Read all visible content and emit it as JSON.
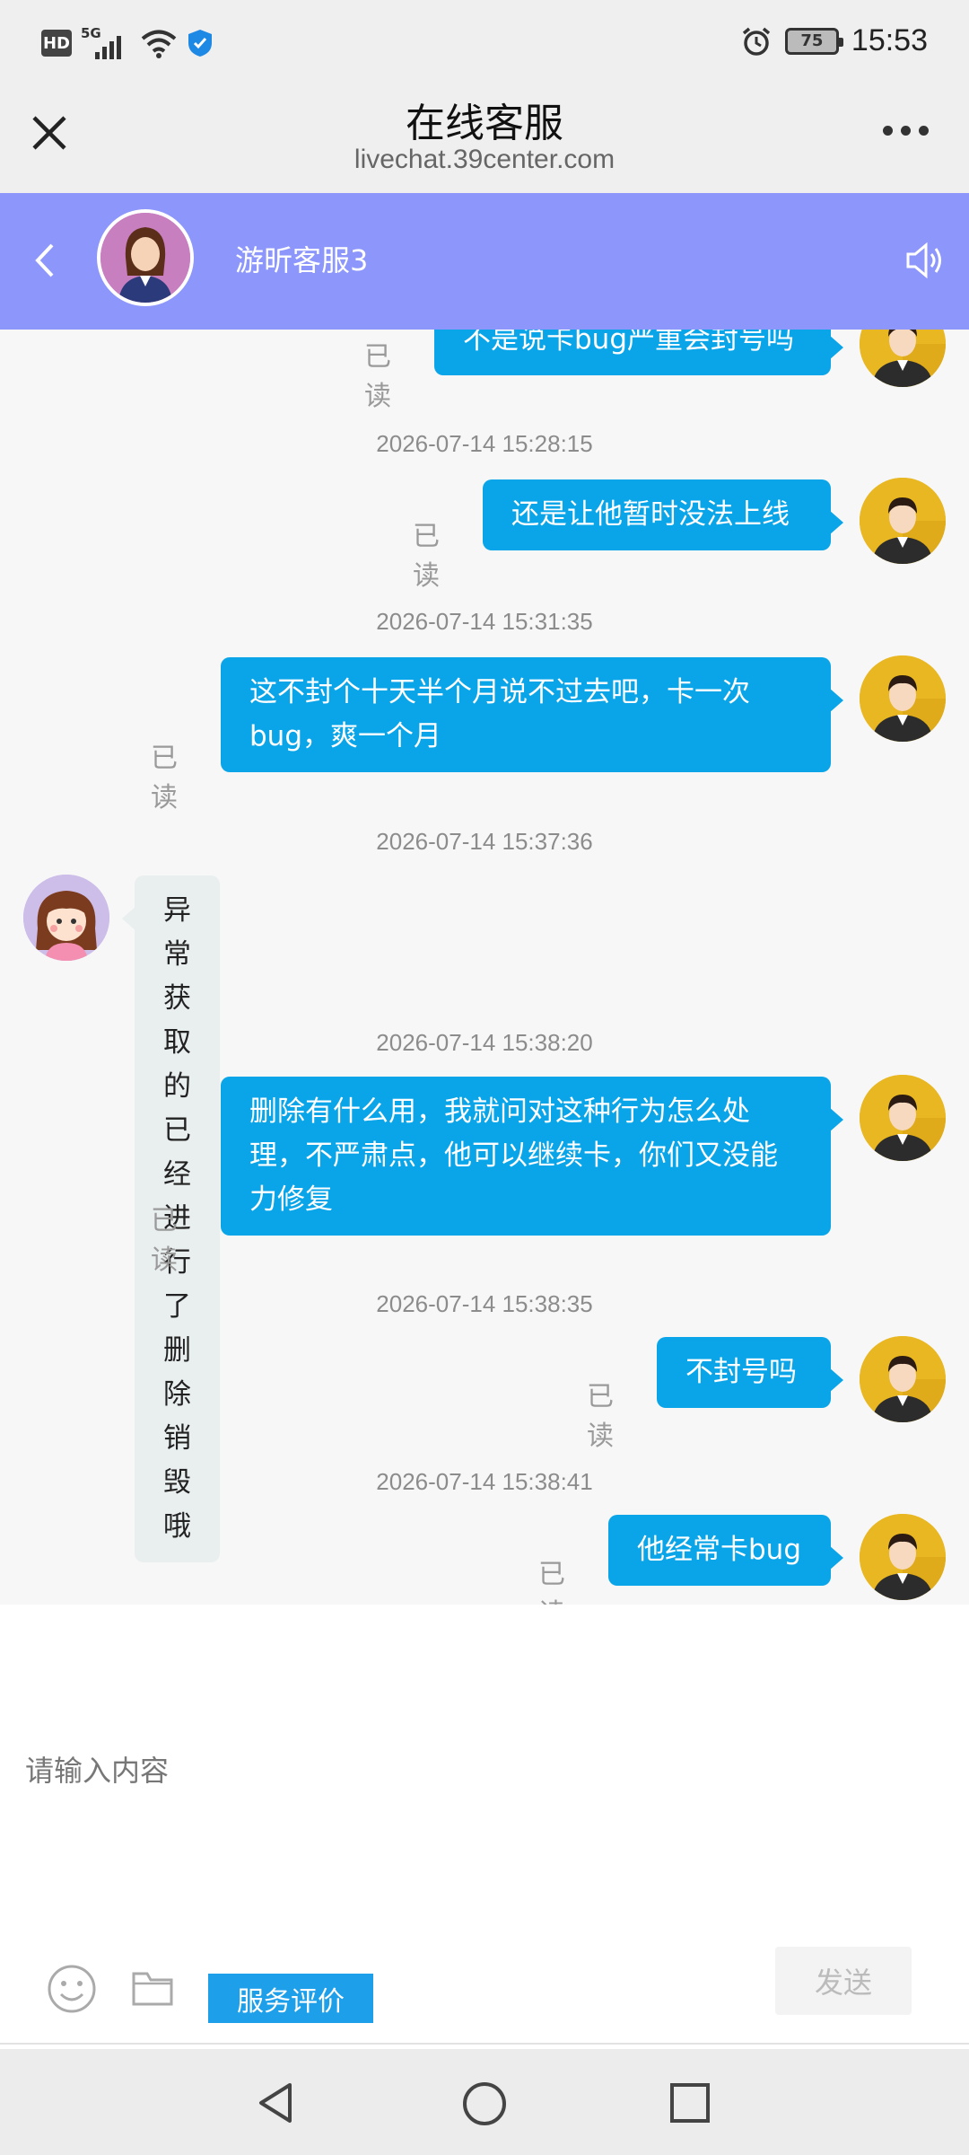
{
  "status_bar": {
    "hd": "HD",
    "network": "5G",
    "battery": "75",
    "time": "15:53",
    "icons": [
      "signal-icon",
      "wifi-icon",
      "shield-icon",
      "alarm-icon",
      "battery-icon"
    ]
  },
  "browser": {
    "title": "在线客服",
    "url": "livechat.39center.com"
  },
  "chat_header": {
    "agent_name": "游昕客服3",
    "header_color": "#8c96fb"
  },
  "messages": [
    {
      "type": "out",
      "text": "不是说卡bug严重会封号吗",
      "status": "已读"
    },
    {
      "type": "timestamp",
      "text": "2026-07-14 15:28:15"
    },
    {
      "type": "out",
      "text": "还是让他暂时没法上线",
      "status": "已读"
    },
    {
      "type": "timestamp",
      "text": "2026-07-14 15:31:35"
    },
    {
      "type": "out",
      "text": "这不封个十天半个月说不过去吧，卡一次bug，爽一个月",
      "status": "已读"
    },
    {
      "type": "timestamp",
      "text": "2026-07-14 15:37:36"
    },
    {
      "type": "in",
      "text": "异常获取的已经进行了删除销毁哦"
    },
    {
      "type": "timestamp",
      "text": "2026-07-14 15:38:20"
    },
    {
      "type": "out",
      "text": "删除有什么用，我就问对这种行为怎么处理，不严肃点，他可以继续卡，你们又没能力修复",
      "status": "已读"
    },
    {
      "type": "timestamp",
      "text": "2026-07-14 15:38:35"
    },
    {
      "type": "out",
      "text": "不封号吗",
      "status": "已读"
    },
    {
      "type": "timestamp",
      "text": "2026-07-14 15:38:41"
    },
    {
      "type": "out",
      "text": "他经常卡bug",
      "status": "已读"
    }
  ],
  "input": {
    "placeholder": "请输入内容",
    "rate_label": "服务评价",
    "send_label": "发送"
  },
  "colors": {
    "bubble_out": "#0aa5e8",
    "bubble_in": "#e9eeef",
    "rate_button": "#1e9fea"
  }
}
